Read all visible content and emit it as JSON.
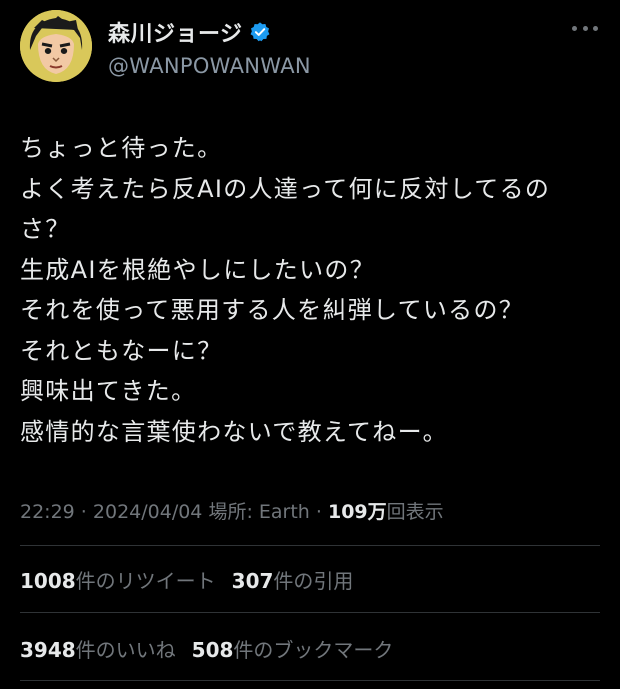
{
  "user": {
    "display_name": "森川ジョージ",
    "handle": "@WANPOWANWAN",
    "verified": true,
    "avatar_icon": "avatar-portrait-icon"
  },
  "tweet": {
    "lines": [
      "ちょっと待った。",
      "よく考えたら反AIの人達って何に反対してるの",
      "さ？",
      "生成AIを根絶やしにしたいの？",
      "それを使って悪用する人を糾弾しているの？",
      "それともなーに？",
      "興味出てきた。",
      "感情的な言葉使わないで教えてねー。"
    ]
  },
  "meta": {
    "time": "22:29",
    "sep1": " · ",
    "date": "2024/04/04",
    "location": " 場所: Earth",
    "sep2": " · ",
    "views_count": "109万",
    "views_label": "回表示"
  },
  "stats": {
    "retweets_count": "1008",
    "retweets_label": "件のリツイート",
    "quotes_count": "307",
    "quotes_label": "件の引用",
    "likes_count": "3948",
    "likes_label": "件のいいね",
    "bookmarks_count": "508",
    "bookmarks_label": "件のブックマーク"
  },
  "colors": {
    "background": "#000000",
    "text_primary": "#e7e9ea",
    "text_secondary": "#71767b",
    "verified_blue": "#1d9bf0",
    "divider": "#2f3336"
  }
}
